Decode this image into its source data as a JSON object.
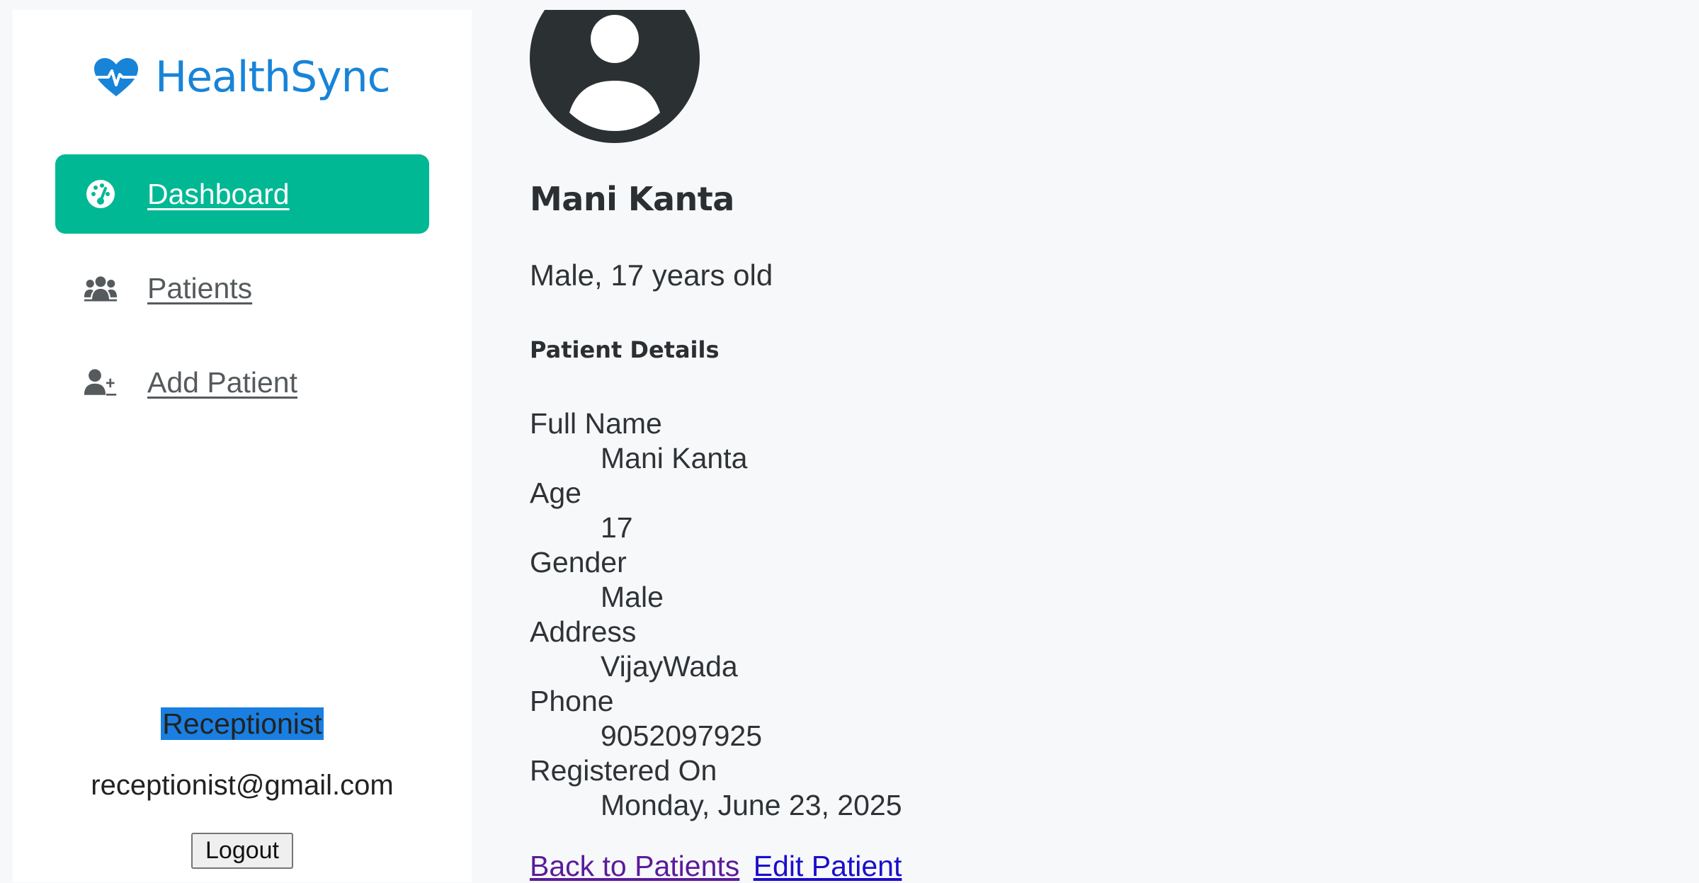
{
  "brand": {
    "name": "HealthSync",
    "color": "#1884d8"
  },
  "nav": {
    "items": [
      {
        "label": "Dashboard",
        "icon": "gauge-icon",
        "active": true
      },
      {
        "label": "Patients",
        "icon": "users-icon",
        "active": false
      },
      {
        "label": "Add Patient",
        "icon": "user-plus-icon",
        "active": false
      }
    ],
    "active_color": "#00b894"
  },
  "user": {
    "role": "Receptionist",
    "email": "receptionist@gmail.com",
    "logout_label": "Logout"
  },
  "patient": {
    "name": "Mani Kanta",
    "summary": "Male, 17 years old",
    "section_title": "Patient Details",
    "details": [
      {
        "label": "Full Name",
        "value": "Mani Kanta"
      },
      {
        "label": "Age",
        "value": "17"
      },
      {
        "label": "Gender",
        "value": "Male"
      },
      {
        "label": "Address",
        "value": "VijayWada"
      },
      {
        "label": "Phone",
        "value": "9052097925"
      },
      {
        "label": "Registered On",
        "value": "Monday, June 23, 2025"
      }
    ]
  },
  "actions": {
    "back_label": "Back to Patients",
    "edit_label": "Edit Patient"
  }
}
